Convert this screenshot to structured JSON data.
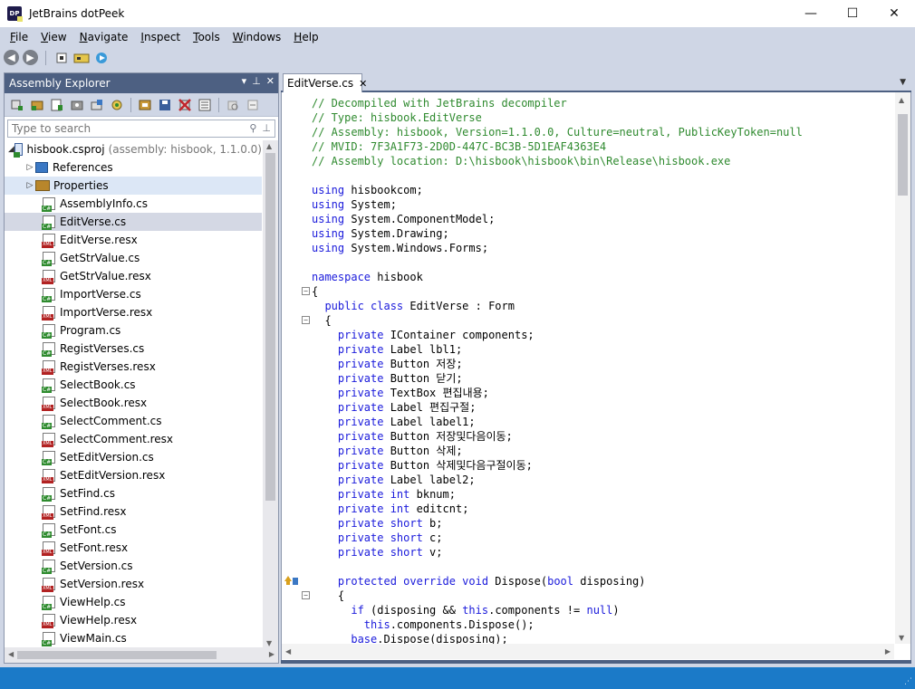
{
  "window": {
    "title": "JetBrains dotPeek",
    "app_icon_text": "DP",
    "minimize_glyph": "—",
    "maximize_glyph": "☐",
    "close_glyph": "✕"
  },
  "menu": [
    {
      "label": "File",
      "u": "F",
      "rest": "ile"
    },
    {
      "label": "View",
      "u": "V",
      "rest": "iew"
    },
    {
      "label": "Navigate",
      "u": "N",
      "rest": "avigate"
    },
    {
      "label": "Inspect",
      "u": "I",
      "rest": "nspect"
    },
    {
      "label": "Tools",
      "u": "T",
      "rest": "ools"
    },
    {
      "label": "Windows",
      "u": "W",
      "rest": "indows"
    },
    {
      "label": "Help",
      "u": "H",
      "rest": "elp"
    }
  ],
  "toolbar": {
    "back_glyph": "◀",
    "forward_glyph": "▶"
  },
  "assembly_explorer": {
    "title": "Assembly Explorer",
    "search_placeholder": "Type to search",
    "project": {
      "name": "hisbook.csproj",
      "note": "(assembly: hisbook, 1.1.0.0)"
    },
    "folders": [
      {
        "name": "References",
        "type": "ref"
      },
      {
        "name": "Properties",
        "type": "folder"
      }
    ],
    "files": [
      {
        "name": "AssemblyInfo.cs",
        "type": "cs"
      },
      {
        "name": "EditVerse.cs",
        "type": "cs",
        "selected": true
      },
      {
        "name": "EditVerse.resx",
        "type": "resx"
      },
      {
        "name": "GetStrValue.cs",
        "type": "cs"
      },
      {
        "name": "GetStrValue.resx",
        "type": "resx"
      },
      {
        "name": "ImportVerse.cs",
        "type": "cs"
      },
      {
        "name": "ImportVerse.resx",
        "type": "resx"
      },
      {
        "name": "Program.cs",
        "type": "cs"
      },
      {
        "name": "RegistVerses.cs",
        "type": "cs"
      },
      {
        "name": "RegistVerses.resx",
        "type": "resx"
      },
      {
        "name": "SelectBook.cs",
        "type": "cs"
      },
      {
        "name": "SelectBook.resx",
        "type": "resx"
      },
      {
        "name": "SelectComment.cs",
        "type": "cs"
      },
      {
        "name": "SelectComment.resx",
        "type": "resx"
      },
      {
        "name": "SetEditVersion.cs",
        "type": "cs"
      },
      {
        "name": "SetEditVersion.resx",
        "type": "resx"
      },
      {
        "name": "SetFind.cs",
        "type": "cs"
      },
      {
        "name": "SetFind.resx",
        "type": "resx"
      },
      {
        "name": "SetFont.cs",
        "type": "cs"
      },
      {
        "name": "SetFont.resx",
        "type": "resx"
      },
      {
        "name": "SetVersion.cs",
        "type": "cs"
      },
      {
        "name": "SetVersion.resx",
        "type": "resx"
      },
      {
        "name": "ViewHelp.cs",
        "type": "cs"
      },
      {
        "name": "ViewHelp.resx",
        "type": "resx"
      },
      {
        "name": "ViewMain.cs",
        "type": "cs"
      }
    ]
  },
  "editor": {
    "tab_label": "EditVerse.cs",
    "lines": [
      [
        [
          "c",
          "// Decompiled with JetBrains decompiler"
        ]
      ],
      [
        [
          "c",
          "// Type: hisbook.EditVerse"
        ]
      ],
      [
        [
          "c",
          "// Assembly: hisbook, Version=1.1.0.0, Culture=neutral, PublicKeyToken=null"
        ]
      ],
      [
        [
          "c",
          "// MVID: 7F3A1F73-2D0D-447C-BC3B-5D1EAF4363E4"
        ]
      ],
      [
        [
          "c",
          "// Assembly location: D:\\hisbook\\hisbook\\bin\\Release\\hisbook.exe"
        ]
      ],
      [],
      [
        [
          "k",
          "using"
        ],
        [
          "t",
          " hisbookcom;"
        ]
      ],
      [
        [
          "k",
          "using"
        ],
        [
          "t",
          " System;"
        ]
      ],
      [
        [
          "k",
          "using"
        ],
        [
          "t",
          " System.ComponentModel;"
        ]
      ],
      [
        [
          "k",
          "using"
        ],
        [
          "t",
          " System.Drawing;"
        ]
      ],
      [
        [
          "k",
          "using"
        ],
        [
          "t",
          " System.Windows.Forms;"
        ]
      ],
      [],
      [
        [
          "k",
          "namespace"
        ],
        [
          "t",
          " hisbook"
        ]
      ],
      [
        [
          "t",
          "{"
        ]
      ],
      [
        [
          "t",
          "  "
        ],
        [
          "k",
          "public class"
        ],
        [
          "t",
          " EditVerse : Form"
        ]
      ],
      [
        [
          "t",
          "  {"
        ]
      ],
      [
        [
          "t",
          "    "
        ],
        [
          "k",
          "private"
        ],
        [
          "t",
          " IContainer components;"
        ]
      ],
      [
        [
          "t",
          "    "
        ],
        [
          "k",
          "private"
        ],
        [
          "t",
          " Label lbl1;"
        ]
      ],
      [
        [
          "t",
          "    "
        ],
        [
          "k",
          "private"
        ],
        [
          "t",
          " Button 저장;"
        ]
      ],
      [
        [
          "t",
          "    "
        ],
        [
          "k",
          "private"
        ],
        [
          "t",
          " Button 닫기;"
        ]
      ],
      [
        [
          "t",
          "    "
        ],
        [
          "k",
          "private"
        ],
        [
          "t",
          " TextBox 편집내용;"
        ]
      ],
      [
        [
          "t",
          "    "
        ],
        [
          "k",
          "private"
        ],
        [
          "t",
          " Label 편집구절;"
        ]
      ],
      [
        [
          "t",
          "    "
        ],
        [
          "k",
          "private"
        ],
        [
          "t",
          " Label label1;"
        ]
      ],
      [
        [
          "t",
          "    "
        ],
        [
          "k",
          "private"
        ],
        [
          "t",
          " Button 저장및다음이동;"
        ]
      ],
      [
        [
          "t",
          "    "
        ],
        [
          "k",
          "private"
        ],
        [
          "t",
          " Button 삭제;"
        ]
      ],
      [
        [
          "t",
          "    "
        ],
        [
          "k",
          "private"
        ],
        [
          "t",
          " Button 삭제및다음구절이동;"
        ]
      ],
      [
        [
          "t",
          "    "
        ],
        [
          "k",
          "private"
        ],
        [
          "t",
          " Label label2;"
        ]
      ],
      [
        [
          "t",
          "    "
        ],
        [
          "k",
          "private int"
        ],
        [
          "t",
          " bknum;"
        ]
      ],
      [
        [
          "t",
          "    "
        ],
        [
          "k",
          "private int"
        ],
        [
          "t",
          " editcnt;"
        ]
      ],
      [
        [
          "t",
          "    "
        ],
        [
          "k",
          "private short"
        ],
        [
          "t",
          " b;"
        ]
      ],
      [
        [
          "t",
          "    "
        ],
        [
          "k",
          "private short"
        ],
        [
          "t",
          " c;"
        ]
      ],
      [
        [
          "t",
          "    "
        ],
        [
          "k",
          "private short"
        ],
        [
          "t",
          " v;"
        ]
      ],
      [],
      [
        [
          "t",
          "    "
        ],
        [
          "k",
          "protected override void"
        ],
        [
          "t",
          " Dispose("
        ],
        [
          "k",
          "bool"
        ],
        [
          "t",
          " disposing)"
        ]
      ],
      [
        [
          "t",
          "    {"
        ]
      ],
      [
        [
          "t",
          "      "
        ],
        [
          "k",
          "if"
        ],
        [
          "t",
          " (disposing && "
        ],
        [
          "k",
          "this"
        ],
        [
          "t",
          ".components != "
        ],
        [
          "k",
          "null"
        ],
        [
          "t",
          ")"
        ]
      ],
      [
        [
          "t",
          "        "
        ],
        [
          "k",
          "this"
        ],
        [
          "t",
          ".components.Dispose();"
        ]
      ],
      [
        [
          "t",
          "      "
        ],
        [
          "k",
          "base"
        ],
        [
          "t",
          ".Dispose(disposing);"
        ]
      ]
    ]
  }
}
